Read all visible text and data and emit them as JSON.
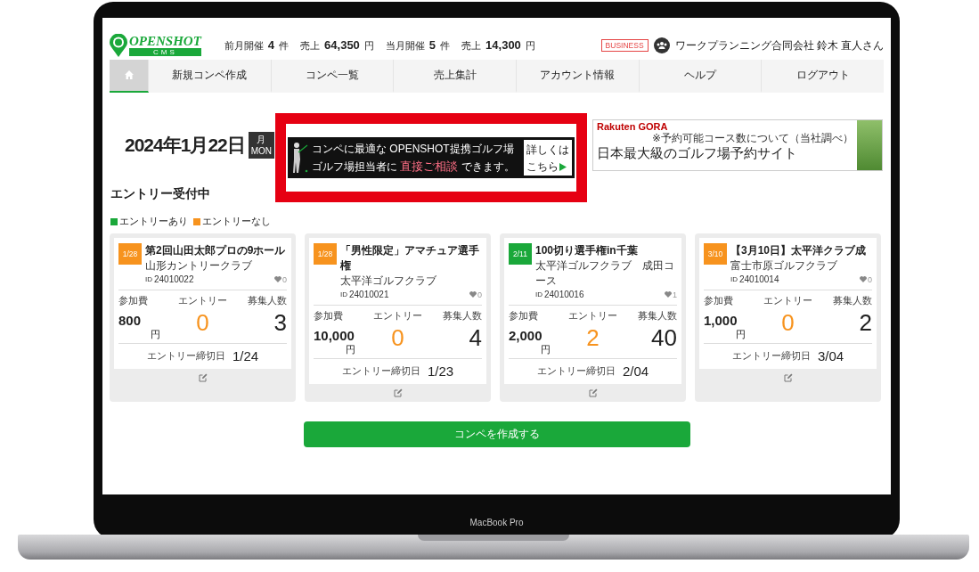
{
  "device": {
    "label": "MacBook Pro"
  },
  "header": {
    "logo": {
      "name": "OPENSHOT",
      "sub": "CMS"
    },
    "stats": [
      {
        "label": "前月開催",
        "value": "4",
        "unit": "件"
      },
      {
        "label": "売上",
        "value": "64,350",
        "unit": "円"
      },
      {
        "label": "当月開催",
        "value": "5",
        "unit": "件"
      },
      {
        "label": "売上",
        "value": "14,300",
        "unit": "円"
      }
    ],
    "badge": "BUSINESS",
    "user": "ワークプランニング合同会社 鈴木 直人さん"
  },
  "nav": [
    {
      "kind": "home",
      "selected": true
    },
    {
      "kind": "text",
      "label": "新規コンペ作成",
      "selected": false
    },
    {
      "kind": "text",
      "label": "コンペ一覧",
      "selected": false
    },
    {
      "kind": "text",
      "label": "売上集計",
      "selected": false
    },
    {
      "kind": "text",
      "label": "アカウント情報",
      "selected": false
    },
    {
      "kind": "text",
      "label": "ヘルプ",
      "selected": false
    },
    {
      "kind": "text",
      "label": "ログアウト",
      "selected": false
    }
  ],
  "date": {
    "text": "2024年1月22日",
    "month": "月",
    "weekday": "MON"
  },
  "promo": {
    "line1": "コンペに最適な OPENSHOT提携ゴルフ場",
    "line2": "ゴルフ場担当者に **直接ご相談** できます。",
    "button_line1": "詳しくは",
    "button_line2": "こちら"
  },
  "ad": {
    "brand": "Rakuten GORA",
    "note": "※予約可能コース数について（当社調べ）",
    "headline": "日本最大級のゴルフ場予約サイト"
  },
  "section_title": "エントリー受付中",
  "legend": [
    {
      "label": "エントリーあり",
      "color": "#1aa83a"
    },
    {
      "label": "エントリーなし",
      "color": "#f7931e"
    }
  ],
  "cards": [
    {
      "date": "1/28",
      "color": "#f7931e",
      "title": "第2回山田太郎プロの9ホール",
      "course": "山形カントリークラブ",
      "id_label": "ID",
      "id": "24010022",
      "likes": "0",
      "fee_label": "参加費",
      "fee": "800",
      "fee_unit": "円",
      "entry_label": "エントリー",
      "entries": "0",
      "capacity_label": "募集人数",
      "capacity": "3",
      "deadline_label": "エントリー締切日",
      "deadline": "1/24"
    },
    {
      "date": "1/28",
      "color": "#f7931e",
      "title": "「男性限定」アマチュア選手権",
      "course": "太平洋ゴルフクラブ",
      "id_label": "ID",
      "id": "24010021",
      "likes": "0",
      "fee_label": "参加費",
      "fee": "10,000",
      "fee_unit": "円",
      "entry_label": "エントリー",
      "entries": "0",
      "capacity_label": "募集人数",
      "capacity": "4",
      "deadline_label": "エントリー締切日",
      "deadline": "1/23"
    },
    {
      "date": "2/11",
      "color": "#1aa83a",
      "title": "100切り選手権in千葉",
      "course": "太平洋ゴルフクラブ　成田コース",
      "id_label": "ID",
      "id": "24010016",
      "likes": "1",
      "fee_label": "参加費",
      "fee": "2,000",
      "fee_unit": "円",
      "entry_label": "エントリー",
      "entries": "2",
      "capacity_label": "募集人数",
      "capacity": "40",
      "deadline_label": "エントリー締切日",
      "deadline": "2/04"
    },
    {
      "date": "3/10",
      "color": "#f7931e",
      "title": "【3月10日】太平洋クラブ成",
      "course": "富士市原ゴルフクラブ",
      "id_label": "ID",
      "id": "24010014",
      "likes": "0",
      "fee_label": "参加費",
      "fee": "1,000",
      "fee_unit": "円",
      "entry_label": "エントリー",
      "entries": "0",
      "capacity_label": "募集人数",
      "capacity": "2",
      "deadline_label": "エントリー締切日",
      "deadline": "3/04"
    }
  ],
  "create_button": "コンペを作成する"
}
